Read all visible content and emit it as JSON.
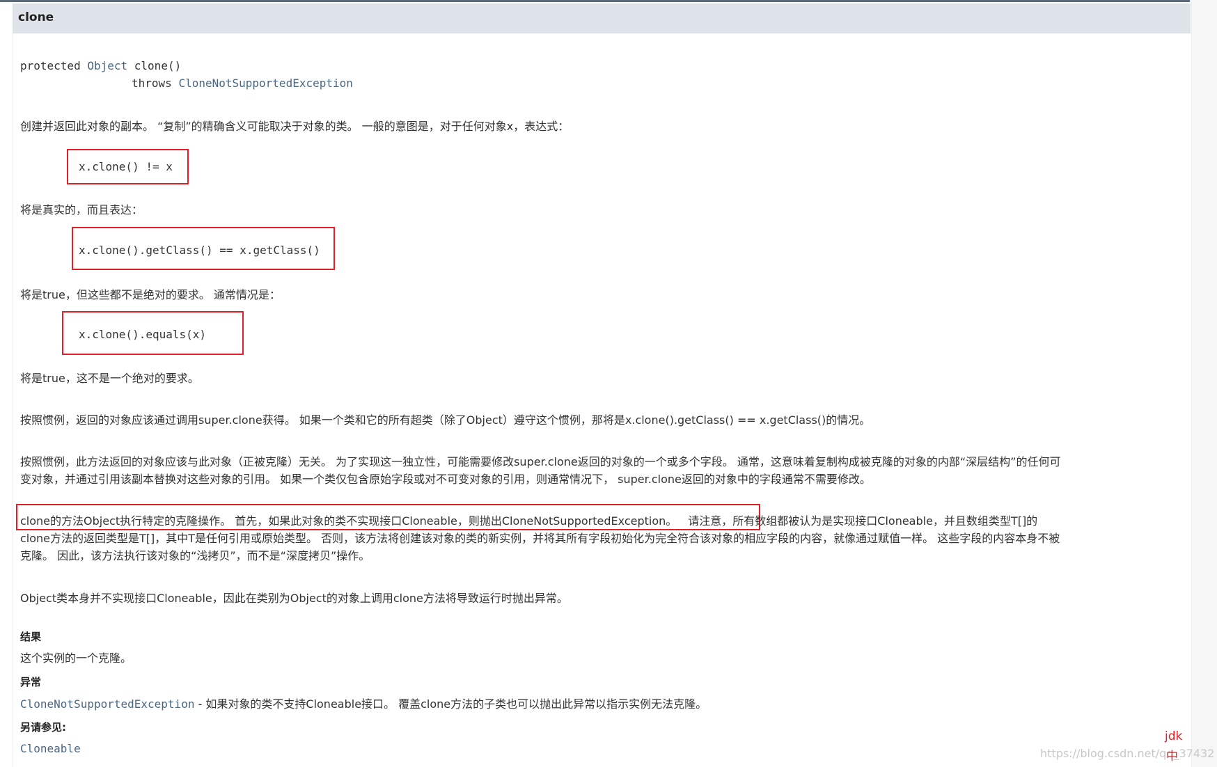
{
  "member": {
    "name": "clone"
  },
  "signature": {
    "modifier": "protected",
    "return_type": "Object",
    "method": "clone()",
    "throws_kw": "throws",
    "exception": "CloneNotSupportedException"
  },
  "desc": {
    "p1": "创建并返回此对象的副本。 “复制”的精确含义可能取决于对象的类。 一般的意图是，对于任何对象x，表达式：",
    "code1": "x.clone() != x",
    "p2": "将是真实的，而且表达：",
    "code2": "x.clone().getClass() == x.getClass()",
    "p3": "将是true，但这些都不是绝对的要求。 通常情况是：",
    "code3": "x.clone().equals(x)",
    "p4": "将是true，这不是一个绝对的要求。",
    "p5": "按照惯例，返回的对象应该通过调用super.clone获得。 如果一个类和它的所有超类（除了Object）遵守这个惯例，那将是x.clone().getClass() == x.getClass()的情况。",
    "p6_line1": "按照惯例，此方法返回的对象应该与此对象（正被克隆）无关。 为了实现这一独立性，可能需要修改super.clone返回的对象的一个或多个字段。 通常，这意味着复制构成被克隆的对象的内部“深层结构”的任何可",
    "p6_line2": "变对象，并通过引用该副本替换对这些对象的引用。 如果一个类仅包含原始字段或对不可变对象的引用，则通常情况下， super.clone返回的对象中的字段通常不需要修改。",
    "p7_highlight": "clone的方法Object执行特定的克隆操作。 首先，如果此对象的类不实现接口Cloneable，则抛出CloneNotSupportedException。",
    "p7_rest1": "请注意，所有数组都被认为是实现接口Cloneable，并且数组类型T[]的",
    "p7_line2": "clone方法的返回类型是T[]，其中T是任何引用或原始类型。 否则，该方法将创建该对象的类的新实例，并将其所有字段初始化为完全符合该对象的相应字段的内容，就像通过赋值一样。 这些字段的内容本身不被",
    "p7_line3": "克隆。 因此，该方法执行该对象的“浅拷贝”，而不是“深度拷贝”操作。",
    "p8": "Object类本身并不实现接口Cloneable，因此在类别为Object的对象上调用clone方法将导致运行时抛出异常。"
  },
  "returns": {
    "label": "结果",
    "text": "这个实例的一个克隆。"
  },
  "throws": {
    "label": "异常",
    "exception": "CloneNotSupportedException",
    "text": " - 如果对象的类不支持Cloneable接口。 覆盖clone方法的子类也可以抛出此异常以指示实例无法克隆。"
  },
  "see_also": {
    "label": "另请参见:",
    "link": "Cloneable"
  },
  "watermark": {
    "tag1": "jdk",
    "tag2": "中",
    "url": "https://blog.csdn.net/qq_37432"
  },
  "colors": {
    "highlight_box": "#e21f26",
    "link": "#4a6782",
    "header_bg": "#dee3e9"
  }
}
